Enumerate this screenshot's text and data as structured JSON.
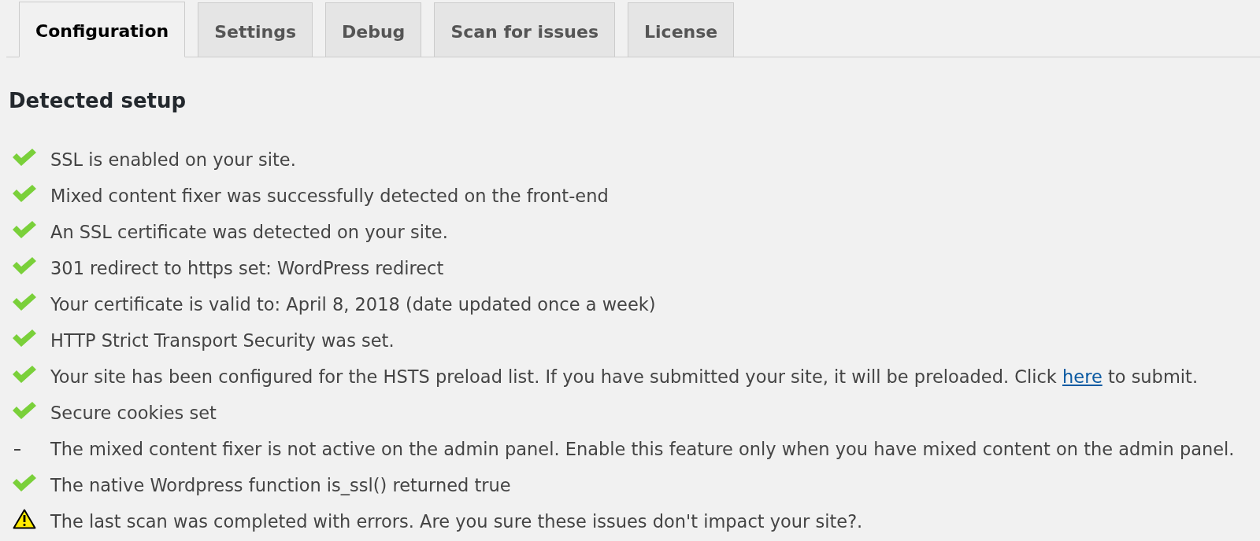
{
  "tabs": [
    {
      "label": "Configuration",
      "selected": true
    },
    {
      "label": "Settings",
      "selected": false
    },
    {
      "label": "Debug",
      "selected": false
    },
    {
      "label": "Scan for issues",
      "selected": false
    },
    {
      "label": "License",
      "selected": false
    }
  ],
  "section": {
    "title": "Detected setup"
  },
  "checks": [
    {
      "kind": "success",
      "text": "SSL is enabled on your site."
    },
    {
      "kind": "success",
      "text": "Mixed content fixer was successfully detected on the front-end"
    },
    {
      "kind": "success",
      "text": "An SSL certificate was detected on your site."
    },
    {
      "kind": "success",
      "text": "301 redirect to https set: WordPress redirect"
    },
    {
      "kind": "success",
      "text": "Your certificate is valid to: April 8, 2018 (date updated once a week)"
    },
    {
      "kind": "success",
      "text": "HTTP Strict Transport Security was set."
    },
    {
      "kind": "success",
      "text": "Your site has been configured for the HSTS preload list. If you have submitted your site, it will be preloaded. Click ",
      "link": "here",
      "text_after": " to submit."
    },
    {
      "kind": "success",
      "text": "Secure cookies set"
    },
    {
      "kind": "neutral",
      "text": "The mixed content fixer is not active on the admin panel. Enable this feature only when you have mixed content on the admin panel."
    },
    {
      "kind": "success",
      "text": "The native Wordpress function is_ssl() returned true"
    },
    {
      "kind": "warning",
      "text": "The last scan was completed with errors. Are you sure these issues don't impact your site?."
    }
  ]
}
